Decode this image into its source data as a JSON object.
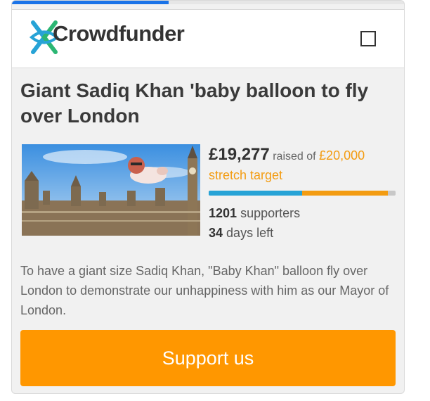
{
  "top_progress": {
    "fraction": 0.4
  },
  "header": {
    "brand": "Crowdfunder",
    "logo_icon": "crowdfunder-logo-icon",
    "menu_icon": "checkbox-icon",
    "brand_colors": {
      "cyan": "#27a3d6",
      "green": "#2bb673"
    }
  },
  "campaign": {
    "title": "Giant Sadiq Khan 'baby balloon to fly over London",
    "raised": "£19,277",
    "raised_text": "raised of",
    "target": "£20,000",
    "stretch_label": "stretch target",
    "progress": {
      "first_target_fraction": 0.5,
      "total_fraction": 0.96,
      "bar_color_blue": "#27a3d6",
      "bar_color_orange": "#f39c12"
    },
    "supporters_count": "1201",
    "supporters_label": "supporters",
    "days_count": "34",
    "days_label": "days left",
    "image_icon": "palace-of-westminster-baby-balloon-photo",
    "description": "To have a giant size Sadiq Khan, \"Baby Khan\" balloon fly over London to demonstrate our unhappiness with him as our Mayor of London.",
    "cta_label": "Support us",
    "cta_color": "#ff9700"
  }
}
